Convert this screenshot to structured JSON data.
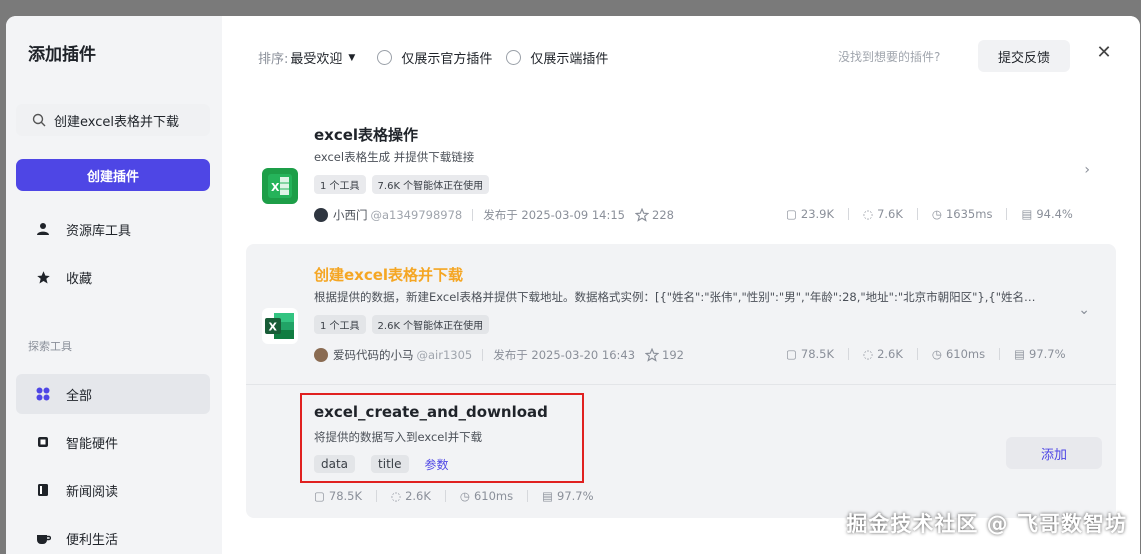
{
  "modal": {
    "title": "添加插件"
  },
  "sidebar": {
    "search_value": "创建excel表格并下载",
    "create_label": "创建插件",
    "items": [
      {
        "label": "资源库工具"
      },
      {
        "label": "收藏"
      }
    ],
    "section_label": "探索工具",
    "explore_items": [
      {
        "label": "全部"
      },
      {
        "label": "智能硬件"
      },
      {
        "label": "新闻阅读"
      },
      {
        "label": "便利生活"
      }
    ]
  },
  "filters": {
    "sort_label": "排序:",
    "sort_value": "最受欢迎",
    "official_only": "仅展示官方插件",
    "endpoint_only": "仅展示端插件",
    "feedback_question": "没找到想要的插件?",
    "feedback_button": "提交反馈"
  },
  "plugins": [
    {
      "title": "excel表格操作",
      "desc": "excel表格生成 并提供下载链接",
      "tags": [
        "1 个工具",
        "7.6K 个智能体正在使用"
      ],
      "author": "小西门",
      "handle": "@a1349798978",
      "published": "发布于 2025-03-09 14:15",
      "stars": "228",
      "stats": [
        "23.9K",
        "7.6K",
        "1635ms",
        "94.4%"
      ]
    },
    {
      "title": "创建excel表格并下载",
      "desc": "根据提供的数据，新建Excel表格并提供下载地址。数据格式实例：[{\"姓名\":\"张伟\",\"性别\":\"男\",\"年龄\":28,\"地址\":\"北京市朝阳区\"},{\"姓名…",
      "tags": [
        "1 个工具",
        "2.6K 个智能体正在使用"
      ],
      "author": "爱码代码的小马",
      "handle": "@air1305",
      "published": "发布于 2025-03-20 16:43",
      "stars": "192",
      "stats": [
        "78.5K",
        "2.6K",
        "610ms",
        "97.7%"
      ]
    }
  ],
  "tool": {
    "title": "excel_create_and_download",
    "desc": "将提供的数据写入到excel并下载",
    "params": [
      "data",
      "title"
    ],
    "params_link": "参数",
    "stats": [
      "78.5K",
      "2.6K",
      "610ms",
      "97.7%"
    ],
    "add_label": "添加"
  },
  "watermark": "掘金技术社区 @ 飞哥数智坊",
  "colors": {
    "accent": "#4e46e5",
    "highlight_title": "#f5a623",
    "excel_green": "#1d9e48"
  }
}
